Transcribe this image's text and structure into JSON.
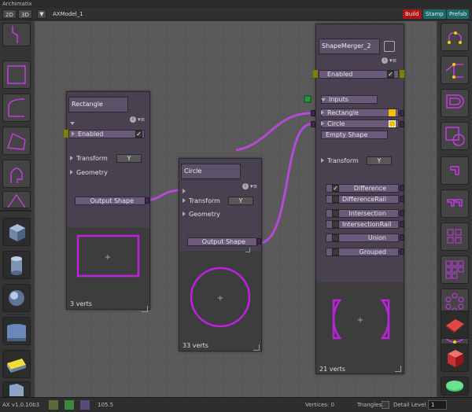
{
  "app": {
    "title": "Archimatix"
  },
  "toolbar": {
    "mode_2d": "2D",
    "mode_3d": "3D",
    "dropdown_arrow": "▼",
    "model_name": "AXModel_1",
    "build": "Build",
    "stamp": "Stamp",
    "prefab": "Prefab",
    "build_color": "#b01515",
    "stamp_color": "#1a6a6a",
    "prefab_color": "#1a6a6a"
  },
  "accent_color": "#c23ce0",
  "left_palette": [
    "polyline-tool-icon",
    "rectangle-shape-icon",
    "arc-shape-icon",
    "quad-shape-icon",
    "arch-shape-icon",
    "house-shape-icon",
    "box-mesh-icon",
    "cylinder-mesh-icon",
    "sphere-mesh-icon",
    "curved-panel-icon",
    "yellow-bevel-icon",
    "book-mesh-icon"
  ],
  "right_palette": [
    "spline-path-icon",
    "branch-nodes-icon",
    "offset-shape-icon",
    "shape-merger-icon",
    "corner-icon",
    "double-corner-icon",
    "grid-shapes-icon",
    "grid-array-icon",
    "radial-array-icon",
    "path-array-icon",
    "red-plane-icon",
    "red-cube-icon",
    "green-disc-icon"
  ],
  "rectangle_node": {
    "name": "Rectangle",
    "enabled": "Enabled",
    "transform": "Transform",
    "transform_btn": "Y",
    "geometry": "Geometry",
    "output": "Output Shape",
    "verts": "3 verts"
  },
  "circle_node": {
    "name": "Circle",
    "transform": "Transform",
    "transform_btn": "Y",
    "geometry": "Geometry",
    "output": "Output Shape",
    "verts": "33 verts"
  },
  "merger_node": {
    "name": "ShapeMerger_2",
    "enabled": "Enabled",
    "inputs": "Inputs",
    "rectangle": "Rectangle",
    "circle": "Circle",
    "empty_shape": "Empty Shape",
    "transform": "Transform",
    "transform_btn": "Y",
    "outputs": [
      "Difference",
      "DifferenceRail",
      "Intersection",
      "IntersectionRail",
      "Union",
      "Grouped"
    ],
    "verts": "21 verts"
  },
  "status": {
    "version": "AX v1.0.10b3",
    "zoom": "105.5",
    "vertices": "Vertices: 0",
    "triangles": "Triangles: 0",
    "detail_label": "Detail Level",
    "detail_value": "1"
  }
}
